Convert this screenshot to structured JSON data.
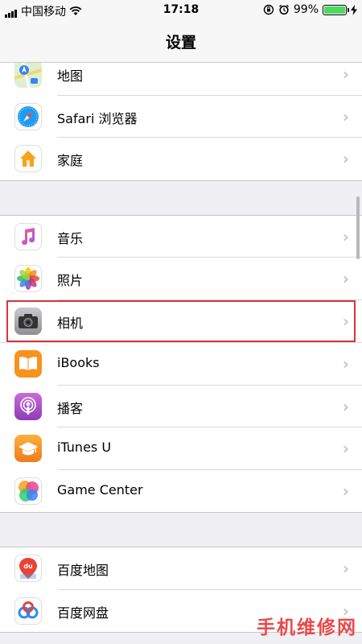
{
  "status_bar": {
    "carrier": "中国移动",
    "time": "17:18",
    "battery_percent": "99%"
  },
  "nav": {
    "title": "设置"
  },
  "groups": [
    [
      {
        "label": "地图",
        "icon": "maps-icon"
      },
      {
        "label": "Safari 浏览器",
        "icon": "safari-icon"
      },
      {
        "label": "家庭",
        "icon": "home-icon"
      }
    ],
    [
      {
        "label": "音乐",
        "icon": "music-icon"
      },
      {
        "label": "照片",
        "icon": "photos-icon"
      },
      {
        "label": "相机",
        "icon": "camera-icon"
      },
      {
        "label": "iBooks",
        "icon": "ibooks-icon"
      },
      {
        "label": "播客",
        "icon": "podcasts-icon"
      },
      {
        "label": "iTunes U",
        "icon": "itunes-u-icon"
      },
      {
        "label": "Game Center",
        "icon": "game-center-icon"
      }
    ],
    [
      {
        "label": "百度地图",
        "icon": "baidu-maps-icon"
      },
      {
        "label": "百度网盘",
        "icon": "baidu-netdisk-icon"
      }
    ]
  ],
  "watermark": "手机维修网",
  "colors": {
    "highlight_border": "#d9353a",
    "battery": "#4cd964"
  }
}
